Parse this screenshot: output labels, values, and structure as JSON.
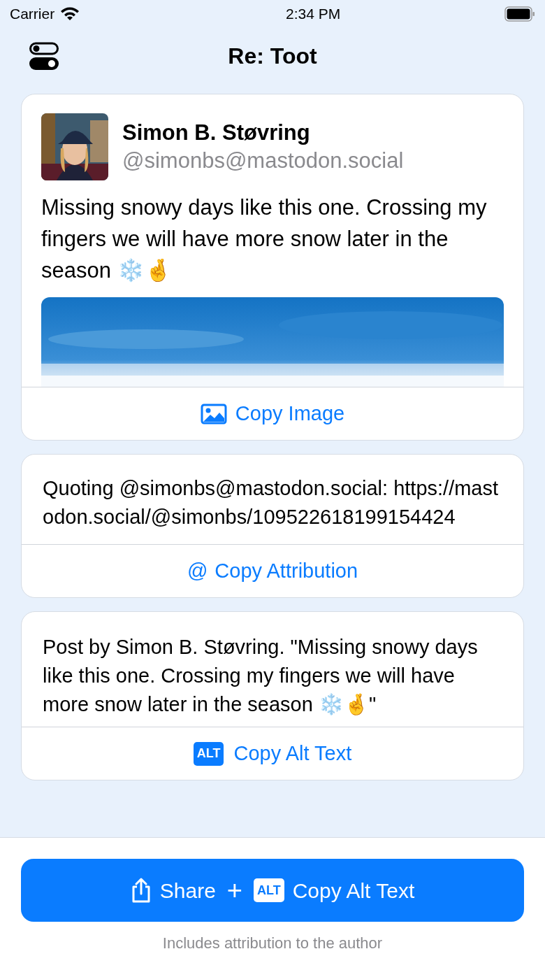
{
  "status_bar": {
    "carrier": "Carrier",
    "time": "2:34 PM"
  },
  "nav": {
    "title": "Re: Toot"
  },
  "post": {
    "name": "Simon B. Støvring",
    "handle": "@simonbs@mastodon.social",
    "text": "Missing snowy days like this one. Crossing my fingers we will have more snow later in the season ❄️🤞",
    "action": "Copy Image"
  },
  "attribution": {
    "text": "Quoting @simonbs@mastodon.social: https://mastodon.social/@simonbs/109522618199154424",
    "action": "Copy Attribution",
    "action_icon": "@"
  },
  "alt_text": {
    "text": "Post by Simon B. Støvring. \"Missing snowy days like this one. Crossing my fingers we will have more snow later in the season ❄️🤞\"",
    "action": "Copy Alt Text",
    "badge": "ALT"
  },
  "primary_button": {
    "share": "Share",
    "plus": "+",
    "badge": "ALT",
    "label": "Copy Alt Text"
  },
  "caption": "Includes attribution to the author"
}
